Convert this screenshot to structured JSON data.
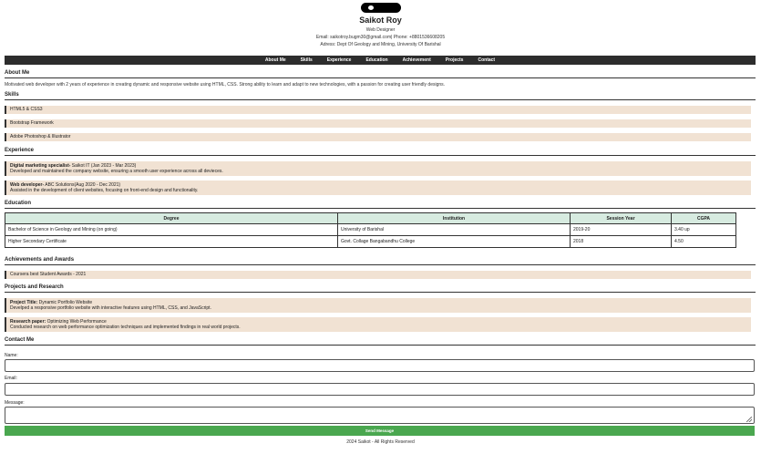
{
  "header": {
    "name": "Saikot Roy",
    "role": "Web Designer",
    "contact_line": "Email: saikotroy.bugm30@gmail.com| Phone: +8801536608205",
    "address": "Adress: Dept Of Geology and Mining, University Of Barishal"
  },
  "nav": [
    "About Me",
    "Skills",
    "Experience",
    "Education",
    "Achievement",
    "Projects",
    "Contact"
  ],
  "about": {
    "title": "About Me",
    "text": "Motivated web developer with 2 years of experience in creating dynamic and responsive website using HTML, CSS. Strong ability to learn and adapt to new technologies, with a passion for creating user friendly designs."
  },
  "skills": {
    "title": "Skills",
    "items": [
      "HTML5 & CSS3",
      "Bootstrap Framework",
      "Adobe Photoshop & Illustrator"
    ]
  },
  "experience": {
    "title": "Experience",
    "items": [
      {
        "role": "Digital marketing specialist-",
        "org": " Saikot IT (Jan 2023 - Mar 2023)",
        "desc": "Developed and maintained the company website, ensuring a smooth user experience across all devieces."
      },
      {
        "role": "Web developer-",
        "org": " ABC Solutions(Aug 2020 - Dec 2021)",
        "desc": "Assisted in the development of client websites, focusing on front-end design and functionality."
      }
    ]
  },
  "education": {
    "title": "Education",
    "headers": [
      "Degree",
      "Institution",
      "Session Year",
      "CGPA"
    ],
    "rows": [
      [
        "Bachelor of Science in Geology and Mining (on going)",
        "University of Barishal",
        "2019-20",
        "3.40 up"
      ],
      [
        "Higher Secondary Certificate",
        "Govt. Collage Bangabandhu College",
        "2018",
        "4.50"
      ]
    ]
  },
  "achievements": {
    "title": "Achievements and Awards",
    "items": [
      "Coursera best Student Awards - 2021"
    ]
  },
  "projects": {
    "title": "Projects and Research",
    "items": [
      {
        "label": "Project Title:",
        "name": " Dynamic Portfolio Website",
        "desc": "Develped a responsive portfolio website with interactive features using HTML, CSS, and JavaScript."
      },
      {
        "label": "Research paper:",
        "name": " Optimizing Web Performance",
        "desc": "Conducted research on web performance optimization techniques and implemented findings in real world projects."
      }
    ]
  },
  "contact": {
    "title": "Contact Me",
    "name_label": "Name:",
    "email_label": "Email:",
    "message_label": "Message:",
    "send_label": "Send Message"
  },
  "footer": "2024 Saikot - All Rights Reserved"
}
